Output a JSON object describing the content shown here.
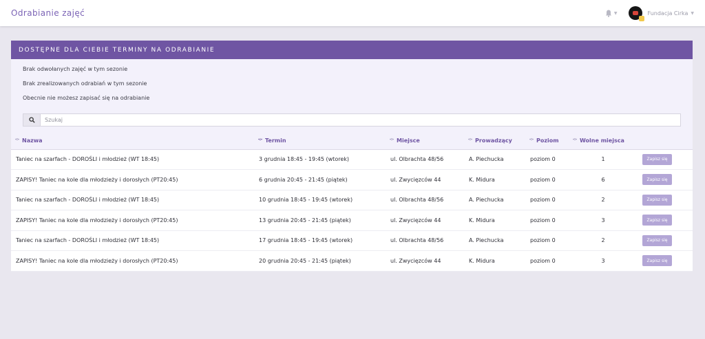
{
  "app": {
    "title": "Odrabianie zajęć"
  },
  "user": {
    "name": "Fundacja Cirka"
  },
  "colors": {
    "accent": "#6f55a3",
    "header_bg": "#6f55a3",
    "info_bg": "#f3f1fb",
    "button": "#b3a6d6",
    "page_bg": "#e9e7ef"
  },
  "icons": {
    "bell": "bell-icon",
    "search": "search-icon",
    "caret": "chevron-down-icon",
    "sort": "sort-icon"
  },
  "card": {
    "title": "DOSTĘPNE DLA CIEBIE TERMINY NA ODRABIANIE",
    "messages": [
      "Brak odwołanych zajęć w tym sezonie",
      "Brak zrealizowanych odrabiań w tym sezonie",
      "Obecnie nie możesz zapisać się na odrabianie"
    ]
  },
  "search": {
    "placeholder": "Szukaj",
    "value": ""
  },
  "table": {
    "columns": [
      "Nazwa",
      "Termin",
      "Miejsce",
      "Prowadzący",
      "Poziom",
      "Wolne miejsca",
      ""
    ],
    "sorted_column": "Termin",
    "button_label": "Zapisz się",
    "rows": [
      {
        "nazwa": "Taniec na szarfach - DOROŚLI i młodzież (WT 18:45)",
        "termin": "3 grudnia 18:45 - 19:45 (wtorek)",
        "miejsce": "ul. Olbrachta 48/56",
        "prowadzacy": "A. Piechucka",
        "poziom": "poziom 0",
        "wolne": "1"
      },
      {
        "nazwa": "ZAPISY! Taniec na kole dla młodzieży i dorosłych (PT20:45)",
        "termin": "6 grudnia 20:45 - 21:45 (piątek)",
        "miejsce": "ul. Zwycięzców 44",
        "prowadzacy": "K. Midura",
        "poziom": "poziom 0",
        "wolne": "6"
      },
      {
        "nazwa": "Taniec na szarfach - DOROŚLI i młodzież (WT 18:45)",
        "termin": "10 grudnia 18:45 - 19:45 (wtorek)",
        "miejsce": "ul. Olbrachta 48/56",
        "prowadzacy": "A. Piechucka",
        "poziom": "poziom 0",
        "wolne": "2"
      },
      {
        "nazwa": "ZAPISY! Taniec na kole dla młodzieży i dorosłych (PT20:45)",
        "termin": "13 grudnia 20:45 - 21:45 (piątek)",
        "miejsce": "ul. Zwycięzców 44",
        "prowadzacy": "K. Midura",
        "poziom": "poziom 0",
        "wolne": "3"
      },
      {
        "nazwa": "Taniec na szarfach - DOROŚLI i młodzież (WT 18:45)",
        "termin": "17 grudnia 18:45 - 19:45 (wtorek)",
        "miejsce": "ul. Olbrachta 48/56",
        "prowadzacy": "A. Piechucka",
        "poziom": "poziom 0",
        "wolne": "2"
      },
      {
        "nazwa": "ZAPISY! Taniec na kole dla młodzieży i dorosłych (PT20:45)",
        "termin": "20 grudnia 20:45 - 21:45 (piątek)",
        "miejsce": "ul. Zwycięzców 44",
        "prowadzacy": "K. Midura",
        "poziom": "poziom 0",
        "wolne": "3"
      }
    ]
  }
}
